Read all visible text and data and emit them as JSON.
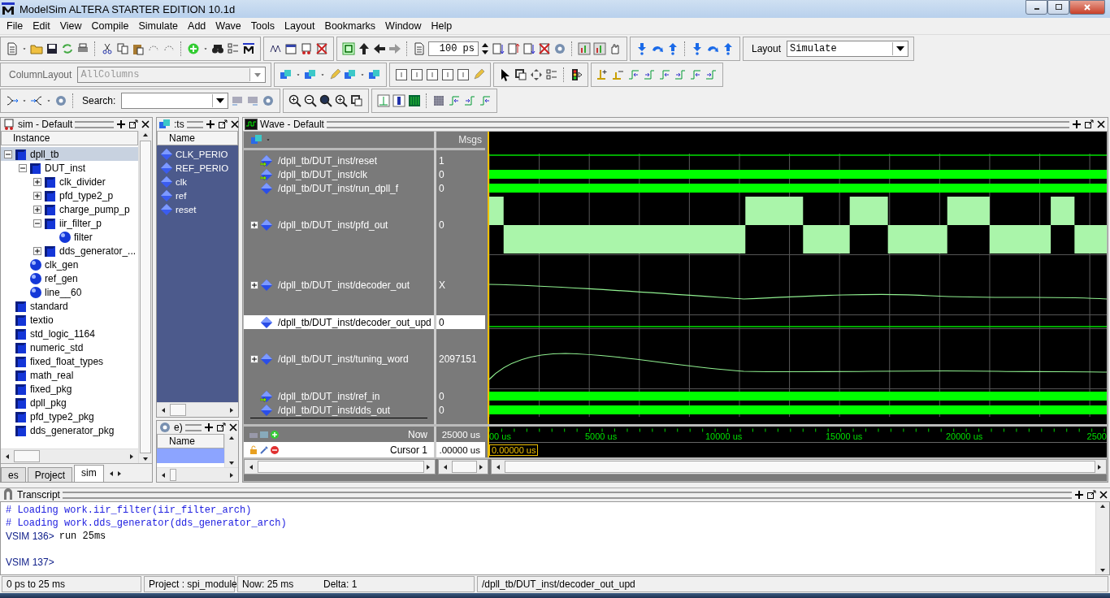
{
  "window": {
    "title": "ModelSim ALTERA STARTER EDITION 10.1d"
  },
  "menu": [
    "File",
    "Edit",
    "View",
    "Compile",
    "Simulate",
    "Add",
    "Wave",
    "Tools",
    "Layout",
    "Bookmarks",
    "Window",
    "Help"
  ],
  "toolbar": {
    "column_layout_label": "ColumnLayout",
    "column_layout_value": "AllColumns",
    "search_label": "Search:",
    "run_length": "100 ps",
    "layout_label": "Layout",
    "layout_value": "Simulate"
  },
  "sim_panel": {
    "title": "sim - Default",
    "column": "Instance",
    "tree": [
      {
        "name": "dpll_tb",
        "kind": "instance",
        "selected": true,
        "expanded": true,
        "children": [
          {
            "name": "DUT_inst",
            "kind": "instance",
            "selected": false,
            "expanded": true,
            "children": [
              {
                "name": "clk_divider",
                "kind": "instance",
                "selected": false,
                "expanded": false
              },
              {
                "name": "pfd_type2_p",
                "kind": "instance",
                "selected": false,
                "expanded": false
              },
              {
                "name": "charge_pump_p",
                "kind": "instance",
                "selected": false,
                "expanded": false
              },
              {
                "name": "iir_filter_p",
                "kind": "instance",
                "selected": false,
                "expanded": true,
                "children": [
                  {
                    "name": "filter",
                    "kind": "process",
                    "selected": false
                  }
                ]
              },
              {
                "name": "dds_generator_...",
                "kind": "instance",
                "selected": false,
                "expanded": false
              }
            ]
          },
          {
            "name": "clk_gen",
            "kind": "process",
            "selected": false
          },
          {
            "name": "ref_gen",
            "kind": "process",
            "selected": false
          },
          {
            "name": "line__60",
            "kind": "process",
            "selected": false
          }
        ]
      },
      {
        "name": "standard",
        "kind": "instance",
        "selected": false
      },
      {
        "name": "textio",
        "kind": "instance",
        "selected": false
      },
      {
        "name": "std_logic_1164",
        "kind": "instance",
        "selected": false
      },
      {
        "name": "numeric_std",
        "kind": "instance",
        "selected": false
      },
      {
        "name": "fixed_float_types",
        "kind": "instance",
        "selected": false
      },
      {
        "name": "math_real",
        "kind": "instance",
        "selected": false
      },
      {
        "name": "fixed_pkg",
        "kind": "instance",
        "selected": false
      },
      {
        "name": "dpll_pkg",
        "kind": "instance",
        "selected": false
      },
      {
        "name": "pfd_type2_pkg",
        "kind": "instance",
        "selected": false
      },
      {
        "name": "dds_generator_pkg",
        "kind": "instance",
        "selected": false
      }
    ],
    "tabs": [
      {
        "label": "es",
        "selected": false
      },
      {
        "label": "Project",
        "selected": false
      },
      {
        "label": "sim",
        "selected": true
      }
    ]
  },
  "objects_panel": {
    "title": ":ts",
    "column": "Name",
    "items": [
      "CLK_PERIO",
      "REF_PERIO",
      "clk",
      "ref",
      "reset"
    ]
  },
  "processes_panel": {
    "title": "e)",
    "column": "Name"
  },
  "wave": {
    "title": "Wave - Default",
    "msgs_header": "Msgs",
    "signals": [
      {
        "name": "/dpll_tb/DUT_inst/reset",
        "value": "1",
        "kind": "high",
        "input_port": true,
        "expandable": false,
        "selected": false
      },
      {
        "name": "/dpll_tb/DUT_inst/clk",
        "value": "0",
        "kind": "dense",
        "input_port": true,
        "expandable": false,
        "selected": false
      },
      {
        "name": "/dpll_tb/DUT_inst/run_dpll_f",
        "value": "0",
        "kind": "dense",
        "input_port": false,
        "expandable": false,
        "selected": false
      },
      {
        "name": "/dpll_tb/DUT_inst/pfd_out",
        "value": "0",
        "kind": "bus",
        "input_port": false,
        "expandable": true,
        "selected": false
      },
      {
        "name": "/dpll_tb/DUT_inst/decoder_out",
        "value": "X",
        "kind": "analog",
        "input_port": false,
        "expandable": true,
        "selected": false
      },
      {
        "name": "/dpll_tb/DUT_inst/decoder_out_upd",
        "value": "0",
        "kind": "low",
        "input_port": false,
        "expandable": false,
        "selected": true
      },
      {
        "name": "/dpll_tb/DUT_inst/tuning_word",
        "value": "2097151",
        "kind": "analog",
        "input_port": false,
        "expandable": true,
        "selected": false
      },
      {
        "name": "/dpll_tb/DUT_inst/ref_in",
        "value": "0",
        "kind": "dense",
        "input_port": true,
        "expandable": false,
        "selected": false
      },
      {
        "name": "/dpll_tb/DUT_inst/dds_out",
        "value": "0",
        "kind": "dense",
        "input_port": false,
        "expandable": false,
        "selected": false
      }
    ],
    "now_label": "Now",
    "now_value": "25000 us",
    "cursor_label": "Cursor 1",
    "cursor_value": ".00000 us",
    "cursor_time": "0.00000 us",
    "timeline_labels": [
      "00 us",
      "5000 us",
      "10000 us",
      "15000 us",
      "20000 us",
      "2500"
    ]
  },
  "transcript": {
    "title": "Transcript",
    "lines": [
      {
        "kind": "comment",
        "text": "# Loading work.iir_filter(iir_filter_arch)"
      },
      {
        "kind": "comment",
        "text": "# Loading work.dds_generator(dds_generator_arch)"
      },
      {
        "kind": "prompt",
        "text": "VSIM 136>",
        "command": "run 25ms"
      },
      {
        "kind": "blank"
      },
      {
        "kind": "prompt",
        "text": "VSIM 137>"
      }
    ]
  },
  "status_bar": [
    "0 ps to 25 ms",
    "Project : spi_module",
    "Now: 25 ms",
    "Delta: 1",
    "/dpll_tb/DUT_inst/decoder_out_upd"
  ]
}
